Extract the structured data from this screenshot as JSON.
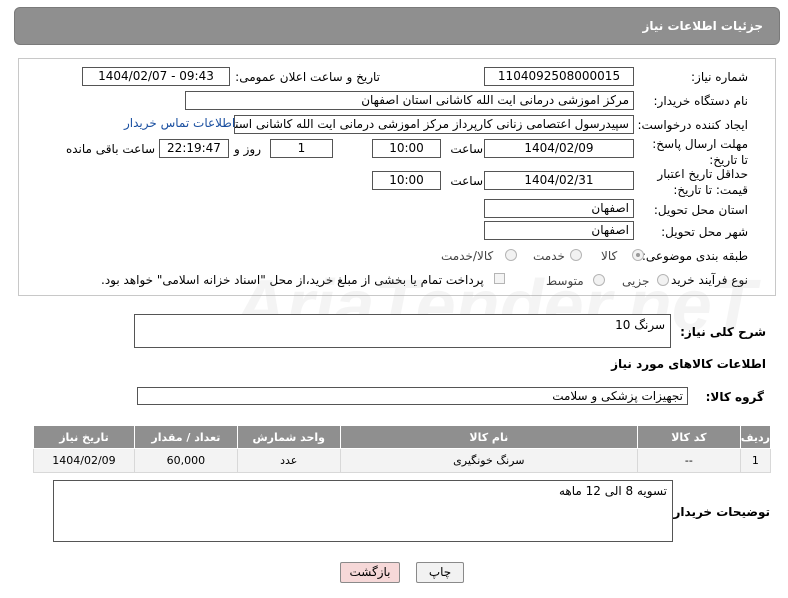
{
  "header": {
    "title": "جزئیات اطلاعات نیاز"
  },
  "fields": {
    "need_number_label": "شماره نیاز:",
    "need_number": "1104092508000015",
    "announce_label": "تاریخ و ساعت اعلان عمومی:",
    "announce_value": "1404/02/07 - 09:43",
    "buyer_org_label": "نام دستگاه خریدار:",
    "buyer_org": "مرکز اموزشی درمانی ایت الله کاشانی استان اصفهان",
    "creator_label": "ایجاد کننده درخواست:",
    "creator": "سپیدرسول اعتصامی زنانی کارپرداز مرکز اموزشی درمانی ایت الله کاشانی استان اصفهان",
    "contact_link": "اطلاعات تماس خریدار",
    "reply_deadline_label": "مهلت ارسال پاسخ: تا تاریخ:",
    "reply_date": "1404/02/09",
    "time_label": "ساعت",
    "reply_time": "10:00",
    "days_value": "1",
    "days_label": "روز و",
    "remaining_time": "22:19:47",
    "remaining_label": "ساعت باقی مانده",
    "price_deadline_label": "حداقل تاریخ اعتبار قیمت: تا تاریخ:",
    "price_date": "1404/02/31",
    "price_time": "10:00",
    "province_label": "استان محل تحویل:",
    "province": "اصفهان",
    "city_label": "شهر محل تحویل:",
    "city": "اصفهان",
    "category_label": "طبقه بندی موضوعی:",
    "category_options": [
      "کالا",
      "خدمت",
      "کالا/خدمت"
    ],
    "process_label": "نوع فرآیند خرید :",
    "process_options": [
      "جزیی",
      "متوسط"
    ],
    "payment_note": "پرداخت تمام یا بخشی از مبلغ خرید،از محل \"اسناد خزانه اسلامی\" خواهد بود."
  },
  "description": {
    "label": "شرح کلی نیاز:",
    "value": "سرنگ 10"
  },
  "goods_section_title": "اطلاعات کالاهای مورد نیاز",
  "goods_group": {
    "label": "گروه کالا:",
    "value": "تجهیزات پزشکی و سلامت"
  },
  "table": {
    "headers": [
      "ردیف",
      "کد کالا",
      "نام کالا",
      "واحد شمارش",
      "تعداد / مقدار",
      "تاریخ نیاز"
    ],
    "rows": [
      [
        "1",
        "--",
        "سرنگ خونگیری",
        "عدد",
        "60,000",
        "1404/02/09"
      ]
    ]
  },
  "buyer_notes": {
    "label": "توضیحات خریدار:",
    "value": "تسویه 8 الی 12 ماهه"
  },
  "buttons": {
    "print": "چاپ",
    "back": "بازگشت"
  },
  "watermark_text": "AriaTender.neT"
}
